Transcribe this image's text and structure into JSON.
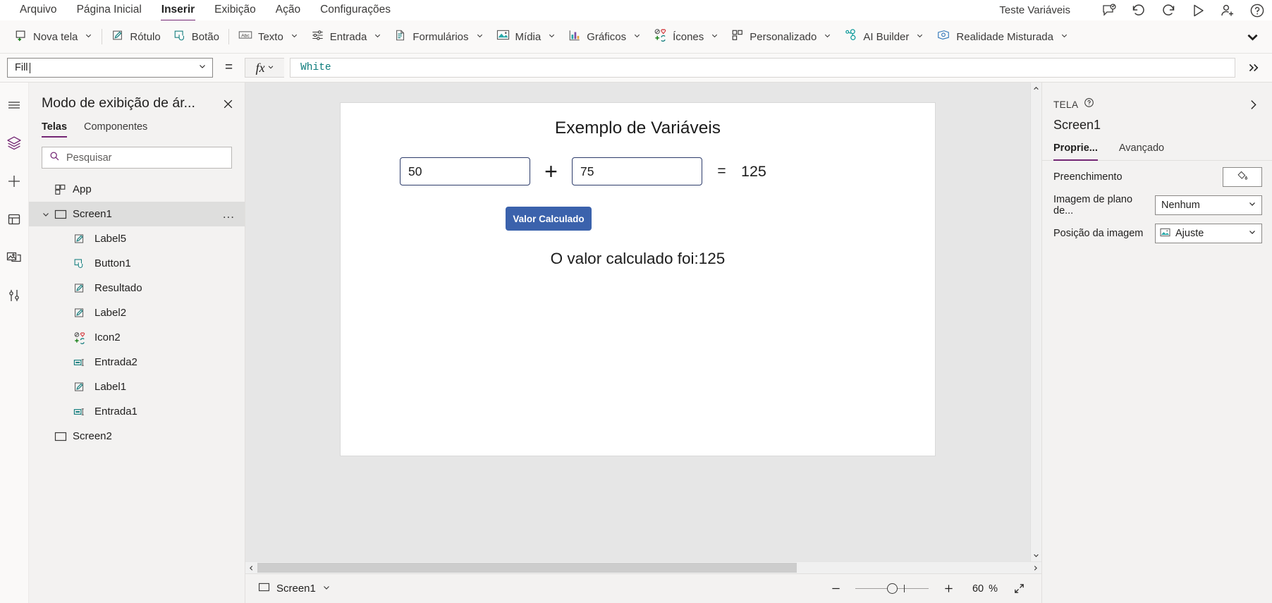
{
  "menubar": {
    "items": [
      {
        "label": "Arquivo",
        "active": false
      },
      {
        "label": "Página Inicial",
        "active": false
      },
      {
        "label": "Inserir",
        "active": true
      },
      {
        "label": "Exibição",
        "active": false
      },
      {
        "label": "Ação",
        "active": false
      },
      {
        "label": "Configurações",
        "active": false
      }
    ],
    "app_title": "Teste Variáveis",
    "right_icons": [
      "comment-icon",
      "undo-icon",
      "redo-icon",
      "play-icon",
      "share-user-icon",
      "help-icon"
    ]
  },
  "ribbon": {
    "groups": [
      {
        "label": "Nova tela",
        "icon": "new-screen-icon",
        "chevron": true
      },
      {
        "label": "Rótulo",
        "icon": "label-icon",
        "chevron": false
      },
      {
        "label": "Botão",
        "icon": "button-icon",
        "chevron": false
      },
      {
        "label": "Texto",
        "icon": "text-input-icon",
        "chevron": true
      },
      {
        "label": "Entrada",
        "icon": "input-slider-icon",
        "chevron": true
      },
      {
        "label": "Formulários",
        "icon": "forms-icon",
        "chevron": true
      },
      {
        "label": "Mídia",
        "icon": "media-image-icon",
        "chevron": true
      },
      {
        "label": "Gráficos",
        "icon": "charts-bar-icon",
        "chevron": true
      },
      {
        "label": "Ícones",
        "icon": "icons-shapes-icon",
        "chevron": true
      },
      {
        "label": "Personalizado",
        "icon": "custom-grid-icon",
        "chevron": true
      },
      {
        "label": "AI Builder",
        "icon": "ai-builder-icon",
        "chevron": true
      },
      {
        "label": "Realidade Misturada",
        "icon": "mixed-reality-icon",
        "chevron": true
      }
    ],
    "overflow_icon": "chevron-down-icon"
  },
  "formula_bar": {
    "property": "Fill",
    "equals": "=",
    "fx_label": "fx",
    "formula": "White"
  },
  "left_rail": {
    "items": [
      {
        "icon": "hamburger-menu-icon",
        "name": "menu"
      },
      {
        "icon": "tree-view-layers-icon",
        "name": "tree-view"
      },
      {
        "icon": "insert-plus-icon",
        "name": "insert"
      },
      {
        "icon": "data-database-icon",
        "name": "data"
      },
      {
        "icon": "media-library-icon",
        "name": "media"
      },
      {
        "icon": "advanced-tools-icon",
        "name": "advanced-tools"
      }
    ]
  },
  "tree_panel": {
    "title": "Modo de exibição de ár...",
    "close_icon": "close-icon",
    "tabs": [
      {
        "label": "Telas",
        "active": true
      },
      {
        "label": "Componentes",
        "active": false
      }
    ],
    "search_placeholder": "Pesquisar",
    "search_icon": "search-icon",
    "items": [
      {
        "label": "App",
        "icon": "app-grid-icon",
        "level": "root-noarrow",
        "expandable": false,
        "selected": false,
        "menu": false
      },
      {
        "label": "Screen1",
        "icon": "screen-icon",
        "level": "root",
        "expandable": true,
        "expanded": true,
        "selected": true,
        "menu": true
      },
      {
        "label": "Label5",
        "icon": "label-icon",
        "level": "child",
        "selected": false,
        "menu": false
      },
      {
        "label": "Button1",
        "icon": "button-icon",
        "level": "child",
        "selected": false,
        "menu": false
      },
      {
        "label": "Resultado",
        "icon": "label-icon",
        "level": "child",
        "selected": false,
        "menu": false
      },
      {
        "label": "Label2",
        "icon": "label-icon",
        "level": "child",
        "selected": false,
        "menu": false
      },
      {
        "label": "Icon2",
        "icon": "icons-shapes-icon",
        "level": "child",
        "selected": false,
        "menu": false
      },
      {
        "label": "Entrada2",
        "icon": "text-input-icon",
        "level": "child",
        "selected": false,
        "menu": false
      },
      {
        "label": "Label1",
        "icon": "label-icon",
        "level": "child",
        "selected": false,
        "menu": false
      },
      {
        "label": "Entrada1",
        "icon": "text-input-icon",
        "level": "child",
        "selected": false,
        "menu": false
      },
      {
        "label": "Screen2",
        "icon": "screen-icon",
        "level": "root-noarrow",
        "expandable": false,
        "selected": false,
        "menu": false
      }
    ],
    "overflow_menu_label": "..."
  },
  "canvas": {
    "app_title": "Exemplo de Variáveis",
    "input1_value": "50",
    "input2_value": "75",
    "plus_symbol": "+",
    "equals_symbol": "=",
    "total_value": "125",
    "button_label": "Valor Calculado",
    "result_text": "O valor calculado foi:125",
    "button_color": "#3b62ac",
    "input_border_color": "#2d3c6b"
  },
  "status_bar": {
    "screen_label": "Screen1",
    "screen_icon": "screen-icon",
    "chevron_icon": "chevron-down-icon",
    "zoom_out_icon": "minus-icon",
    "zoom_in_icon": "plus-icon",
    "zoom_value": "60",
    "zoom_unit": "%",
    "fit_icon": "fit-screen-icon"
  },
  "properties": {
    "kicker": "TELA",
    "help_icon": "help-circle-icon",
    "collapse_icon": "chevron-right-icon",
    "name": "Screen1",
    "tabs": [
      {
        "label": "Proprie...",
        "active": true
      },
      {
        "label": "Avançado",
        "active": false
      }
    ],
    "rows": [
      {
        "label": "Preenchimento",
        "type": "color",
        "value": "",
        "icon": "paint-bucket-icon"
      },
      {
        "label": "Imagem de plano de...",
        "type": "select",
        "value": "Nenhum",
        "icon": ""
      },
      {
        "label": "Posição da imagem",
        "type": "select",
        "value": "Ajuste",
        "icon": "image-position-icon"
      }
    ]
  },
  "accent": {
    "purple": "#742774",
    "teal": "#0f7b7b",
    "blue": "#3b62ac"
  }
}
